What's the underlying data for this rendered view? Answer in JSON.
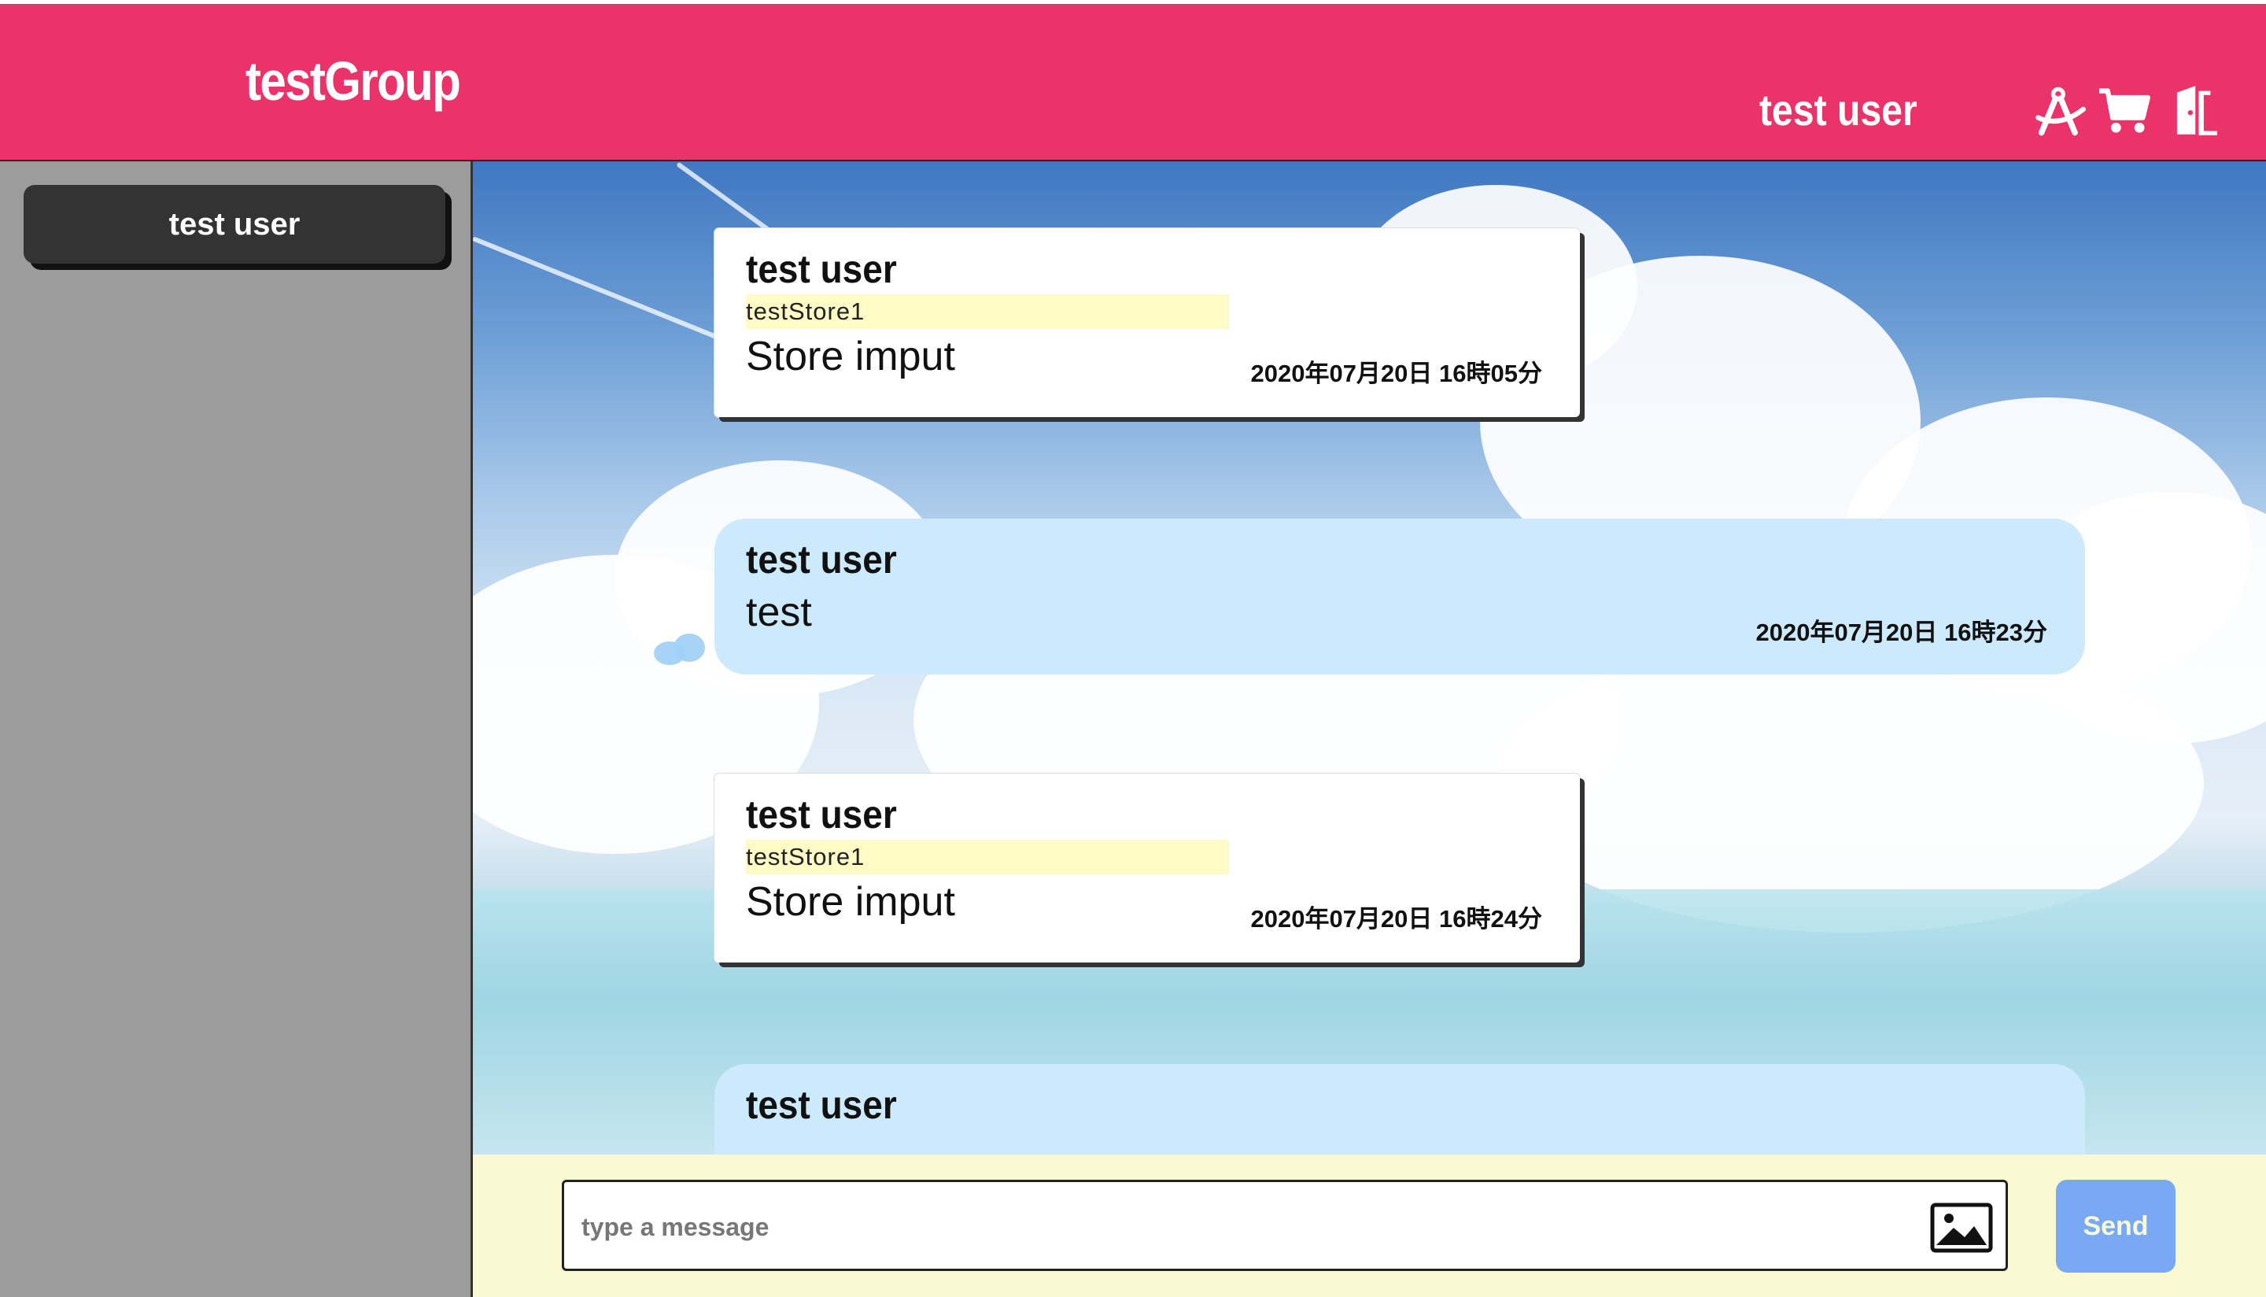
{
  "header": {
    "group_title": "testGroup",
    "user_name": "test user",
    "icons": [
      "compass-tool-icon",
      "cart-icon",
      "logout-door-icon"
    ]
  },
  "sidebar": {
    "items": [
      {
        "label": "test user"
      }
    ]
  },
  "messages": [
    {
      "kind": "store",
      "name": "test user",
      "store": "testStore1",
      "body": "Store imput",
      "time": "2020年07月20日 16時05分"
    },
    {
      "kind": "plain",
      "name": "test user",
      "body": "test",
      "time": "2020年07月20日 16時23分"
    },
    {
      "kind": "store",
      "name": "test user",
      "store": "testStore1",
      "body": "Store imput",
      "time": "2020年07月20日 16時24分"
    },
    {
      "kind": "plain",
      "name": "test user",
      "body": "",
      "time": ""
    }
  ],
  "composer": {
    "placeholder": "type a message",
    "send_label": "Send",
    "image_icon": "image-icon"
  },
  "colors": {
    "header_bg": "#ea336a",
    "sidebar_bg": "#9c9c9c",
    "store_tag_bg": "#fffbc6",
    "plain_msg_bg": "#cdeafd",
    "footer_bg": "#fbf9d2",
    "send_bg": "#7aa9f4"
  }
}
